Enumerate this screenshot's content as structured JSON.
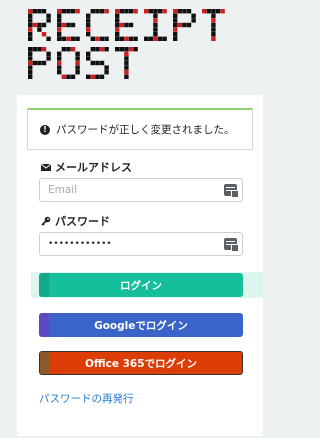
{
  "brand": {
    "line1": "RECEIPT",
    "line2": "POST",
    "dot_color": "#cc1f1f",
    "ink_color": "#111111"
  },
  "alert": {
    "icon": "info-circle-icon",
    "message": "パスワードが正しく変更されました。",
    "accent": "#8fd16c"
  },
  "email": {
    "icon": "envelope-icon",
    "label": "メールアドレス",
    "placeholder": "Email",
    "value": ""
  },
  "password": {
    "icon": "key-icon",
    "label": "パスワード",
    "value": "••••••••••••"
  },
  "buttons": {
    "login": "ログイン",
    "google": "Googleでログイン",
    "office": "Office 365でログイン"
  },
  "links": {
    "reset": "パスワードの再発行"
  },
  "colors": {
    "login": "#16bf9c",
    "google": "#3a64c8",
    "office": "#dc3d06",
    "link": "#2a7bd0"
  }
}
